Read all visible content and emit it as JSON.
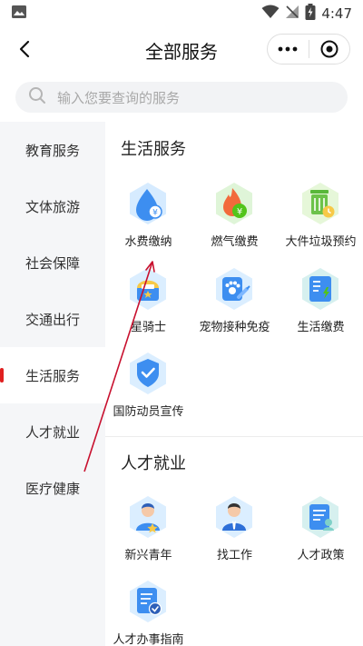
{
  "status": {
    "time": "4:47"
  },
  "nav": {
    "title": "全部服务"
  },
  "search": {
    "placeholder": "输入您要查询的服务"
  },
  "sidebar": {
    "items": [
      {
        "label": "教育服务"
      },
      {
        "label": "文体旅游"
      },
      {
        "label": "社会保障"
      },
      {
        "label": "交通出行"
      },
      {
        "label": "生活服务"
      },
      {
        "label": "人才就业"
      },
      {
        "label": "医疗健康"
      }
    ],
    "active_index": 4
  },
  "sections": [
    {
      "title": "生活服务",
      "items": [
        {
          "label": "水费缴纳",
          "icon": "water-drop-icon"
        },
        {
          "label": "燃气缴费",
          "icon": "gas-flame-icon"
        },
        {
          "label": "大件垃圾预约",
          "icon": "trash-bin-icon"
        },
        {
          "label": "星骑士",
          "icon": "knight-helmet-icon"
        },
        {
          "label": "宠物接种免疫",
          "icon": "pet-vaccine-icon"
        },
        {
          "label": "生活缴费",
          "icon": "bill-payment-icon"
        },
        {
          "label": "国防动员宣传",
          "icon": "shield-check-icon"
        }
      ]
    },
    {
      "title": "人才就业",
      "items": [
        {
          "label": "新兴青年",
          "icon": "youth-person-icon"
        },
        {
          "label": "找工作",
          "icon": "job-person-icon"
        },
        {
          "label": "人才政策",
          "icon": "policy-document-icon"
        },
        {
          "label": "人才办事指南",
          "icon": "guide-book-icon"
        }
      ]
    }
  ],
  "colors": {
    "accent_red": "#e02020",
    "icon_blue": "#3d8ef0",
    "sidebar_bg": "#f5f6f8",
    "annotation_arrow": "#c8102e"
  }
}
